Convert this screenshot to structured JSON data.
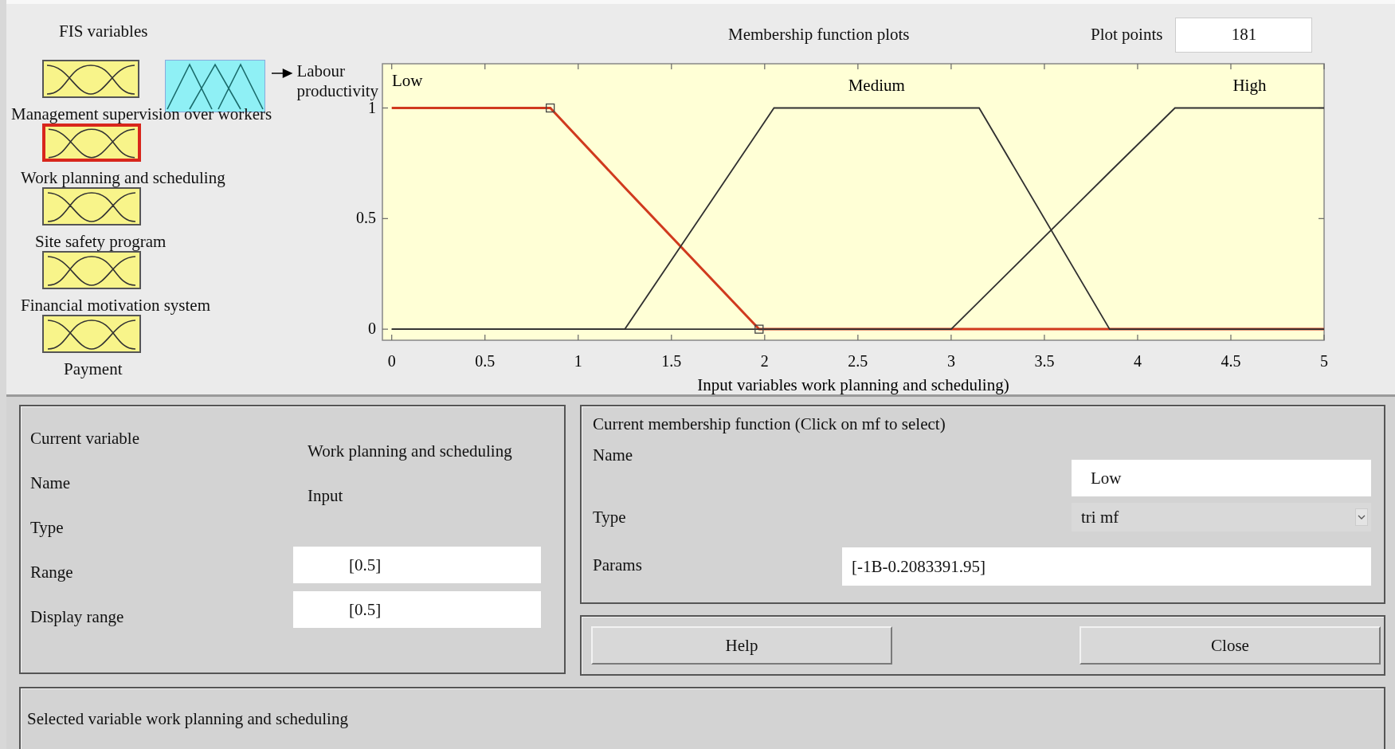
{
  "fis_variables": {
    "title": "FIS variables",
    "inputs": [
      {
        "label": "Management supervision over workers",
        "selected": false
      },
      {
        "label": "Work planning and scheduling",
        "selected": true
      },
      {
        "label": "Site safety program",
        "selected": false
      },
      {
        "label": "Financial motivation system",
        "selected": false
      },
      {
        "label": "Payment",
        "selected": false
      }
    ],
    "output": {
      "label": "Labour productivity",
      "selected": false
    }
  },
  "plot": {
    "plot_points_label": "Plot points",
    "plot_points": "181",
    "chart_data": {
      "type": "line",
      "title": "Membership function plots",
      "xlabel": "Input variables work planning and scheduling)",
      "x": [
        0,
        0.85,
        1.25,
        1.97,
        2.05,
        3,
        3.15,
        3.85,
        4.2,
        5
      ],
      "series": [
        {
          "name": "Low",
          "color": "#d03a1e",
          "values": [
            1,
            1,
            0.64,
            0,
            0,
            0,
            0,
            0,
            0,
            0
          ]
        },
        {
          "name": "Medium",
          "color": "#303030",
          "values": [
            0,
            0,
            0,
            0.9,
            1,
            1,
            1,
            0,
            0,
            0
          ]
        },
        {
          "name": "High",
          "color": "#303030",
          "values": [
            0,
            0,
            0,
            0,
            0,
            0,
            0.125,
            0.71,
            1,
            1
          ]
        }
      ],
      "xlim": [
        -0.05,
        5
      ],
      "ylim": [
        -0.05,
        1.2
      ],
      "xticks": [
        0,
        0.5,
        1,
        1.5,
        2,
        2.5,
        3,
        3.5,
        4,
        4.5,
        5
      ],
      "yticks": [
        0,
        0.5,
        1
      ]
    }
  },
  "current_variable": {
    "title": "Current variable",
    "name_label": "Name",
    "name": "Work planning and scheduling",
    "type_label": "Type",
    "type": "Input",
    "range_label": "Range",
    "range": "[0.5]",
    "display_range_label": "Display range",
    "display_range": "[0.5]"
  },
  "current_mf": {
    "title": "Current membership function (Click on mf to select)",
    "name_label": "Name",
    "name": "Low",
    "type_label": "Type",
    "type": "tri mf",
    "params_label": "Params",
    "params": "[-1B-0.2083391.95]"
  },
  "buttons": [
    "Help",
    "Close"
  ],
  "status": "Selected variable work planning and scheduling"
}
